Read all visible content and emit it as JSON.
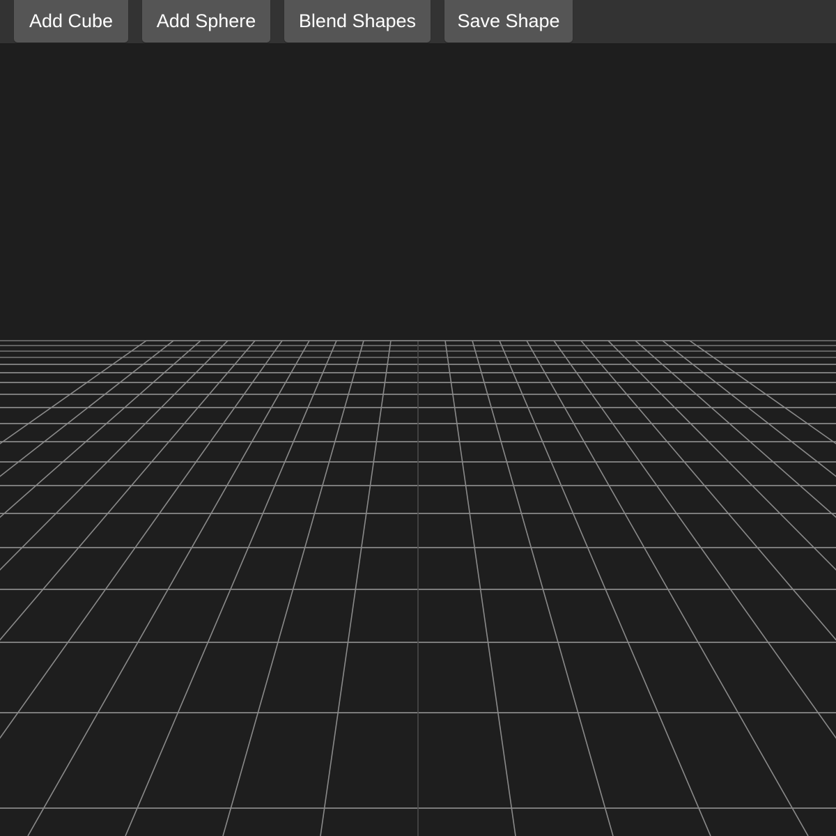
{
  "toolbar": {
    "buttons": [
      {
        "label": "Add Cube"
      },
      {
        "label": "Add Sphere"
      },
      {
        "label": "Blend Shapes"
      },
      {
        "label": "Save Shape"
      }
    ]
  },
  "scene": {
    "background": "#1e1e1e",
    "grid_color": "#8a8a8a",
    "grid_center_line_color": "#4a4a4a"
  }
}
